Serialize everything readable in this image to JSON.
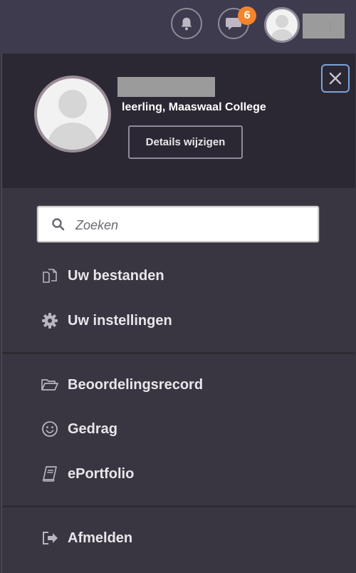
{
  "header": {
    "notifications_label": "Meldingen",
    "messages_badge": "6"
  },
  "profile": {
    "role_text": "leerling, Maaswaal College",
    "details_button": "Details wijzigen"
  },
  "search": {
    "placeholder": "Zoeken"
  },
  "menu": {
    "group1": [
      {
        "label": "Uw bestanden",
        "icon": "files-icon"
      },
      {
        "label": "Uw instellingen",
        "icon": "gear-icon"
      }
    ],
    "group2": [
      {
        "label": "Beoordelingsrecord",
        "icon": "folder-open-icon"
      },
      {
        "label": "Gedrag",
        "icon": "smiley-icon"
      },
      {
        "label": "ePortfolio",
        "icon": "book-icon"
      }
    ],
    "group3": [
      {
        "label": "Afmelden",
        "icon": "sign-out-icon"
      }
    ]
  },
  "colors": {
    "badge": "#f5842a",
    "close_border": "#7aa3d9",
    "panel_bg": "#3a3641",
    "profile_bg": "#2c2833"
  }
}
